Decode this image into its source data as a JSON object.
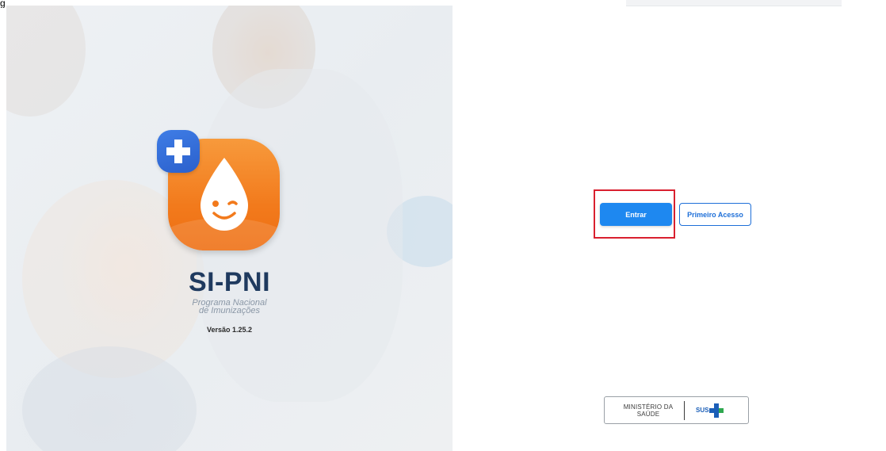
{
  "top_fragment": "g",
  "app": {
    "name": "SI-PNI",
    "subtitle_line1": "Programa Nacional",
    "subtitle_line2": "de Imunizações",
    "version": "Versão 1.25.2"
  },
  "actions": {
    "login_label": "Entrar",
    "first_access_label": "Primeiro Acesso"
  },
  "footer": {
    "ministerio_line1": "MINISTÉRIO DA",
    "ministerio_line2": "SAÚDE",
    "sus": "SUS"
  },
  "colors": {
    "primary_button": "#1e88f0",
    "outline_button": "#1e6fd8",
    "highlight_box": "#d9202f",
    "app_icon_orange": "#f27a1c",
    "badge_blue": "#2b60cc",
    "title_navy": "#1f3a5f"
  },
  "icons": [
    "plus-cross-icon",
    "smiling-drop-icon",
    "sus-cross-icon"
  ]
}
